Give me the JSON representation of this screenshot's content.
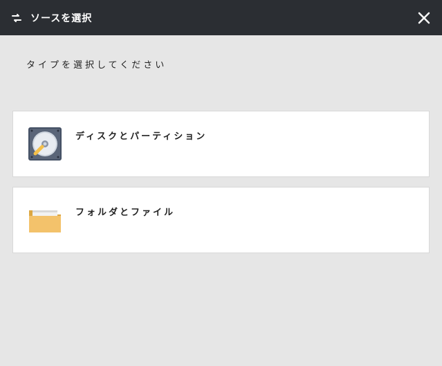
{
  "header": {
    "title": "ソースを選択"
  },
  "instruction": "タイプを選択してください",
  "options": [
    {
      "label": "ディスクとパーティション"
    },
    {
      "label": "フォルダとファイル"
    }
  ]
}
